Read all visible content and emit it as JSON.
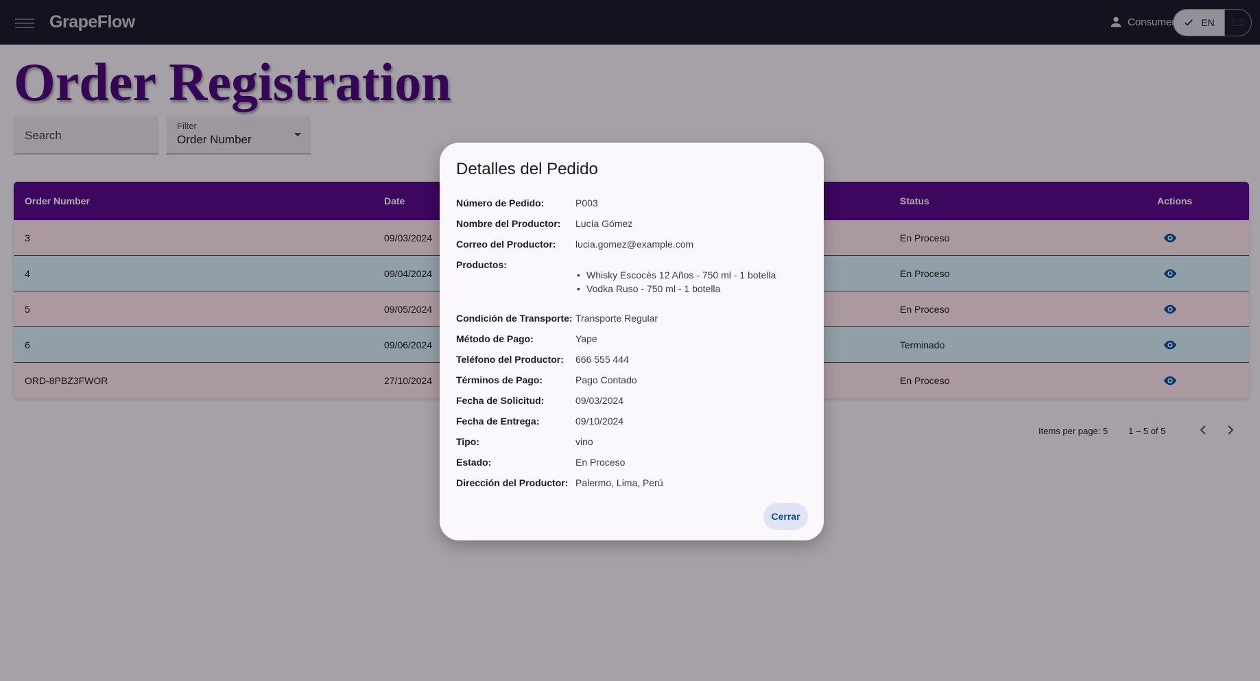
{
  "app": {
    "brand": "GrapeFlow",
    "user_label": "Consumer",
    "lang_selected": "EN",
    "lang_other": "ES"
  },
  "page": {
    "title": "Order Registration",
    "search_placeholder": "Search",
    "filter_label": "Filter",
    "filter_value": "Order Number"
  },
  "table": {
    "headers": {
      "order_number": "Order Number",
      "date": "Date",
      "status": "Status",
      "actions": "Actions"
    },
    "rows": [
      {
        "order_number": "3",
        "date": "09/03/2024",
        "status": "En Proceso"
      },
      {
        "order_number": "4",
        "date": "09/04/2024",
        "status": "En Proceso"
      },
      {
        "order_number": "5",
        "date": "09/05/2024",
        "status": "En Proceso"
      },
      {
        "order_number": "6",
        "date": "09/06/2024",
        "status": "Terminado"
      },
      {
        "order_number": "ORD-8PBZ3FWOR",
        "date": "27/10/2024",
        "status": "En Proceso"
      }
    ]
  },
  "paginator": {
    "items_per_page": "Items per page: 5",
    "range": "1 – 5 of 5"
  },
  "dialog": {
    "title": "Detalles del Pedido",
    "fields": {
      "order_number": {
        "label": "Número de Pedido:",
        "value": "P003"
      },
      "producer_name": {
        "label": "Nombre del Productor:",
        "value": "Lucía Gómez"
      },
      "producer_email": {
        "label": "Correo del Productor:",
        "value": "lucia.gomez@example.com"
      },
      "products": {
        "label": "Productos:"
      },
      "transport": {
        "label": "Condición de Transporte:",
        "value": "Transporte Regular"
      },
      "payment_method": {
        "label": "Método de Pago:",
        "value": "Yape"
      },
      "producer_phone": {
        "label": "Teléfono del Productor:",
        "value": "666 555 444"
      },
      "payment_terms": {
        "label": "Términos de Pago:",
        "value": "Pago Contado"
      },
      "request_date": {
        "label": "Fecha de Solicitud:",
        "value": "09/03/2024"
      },
      "delivery_date": {
        "label": "Fecha de Entrega:",
        "value": "09/10/2024"
      },
      "type": {
        "label": "Tipo:",
        "value": "vino"
      },
      "state": {
        "label": "Estado:",
        "value": "En Proceso"
      },
      "producer_address": {
        "label": "Dirección del Productor:",
        "value": "Palermo, Lima, Perú"
      }
    },
    "products": [
      "Whisky Escocés 12 Años - 750 ml - 1 botella",
      "Vodka Ruso - 750 ml - 1 botella"
    ],
    "close_label": "Cerrar"
  },
  "colors": {
    "topbar": "#1c1b2e",
    "title": "#4f0a7f",
    "table_header": "#5a0a8c",
    "row_pink": "#fbe3eb",
    "row_blue": "#d6ecf8",
    "eye_icon": "#0b4fa0"
  },
  "icons": [
    "menu-icon",
    "user-icon",
    "check-icon",
    "caret-down-icon",
    "eye-icon",
    "chevron-left-icon",
    "chevron-right-icon"
  ]
}
